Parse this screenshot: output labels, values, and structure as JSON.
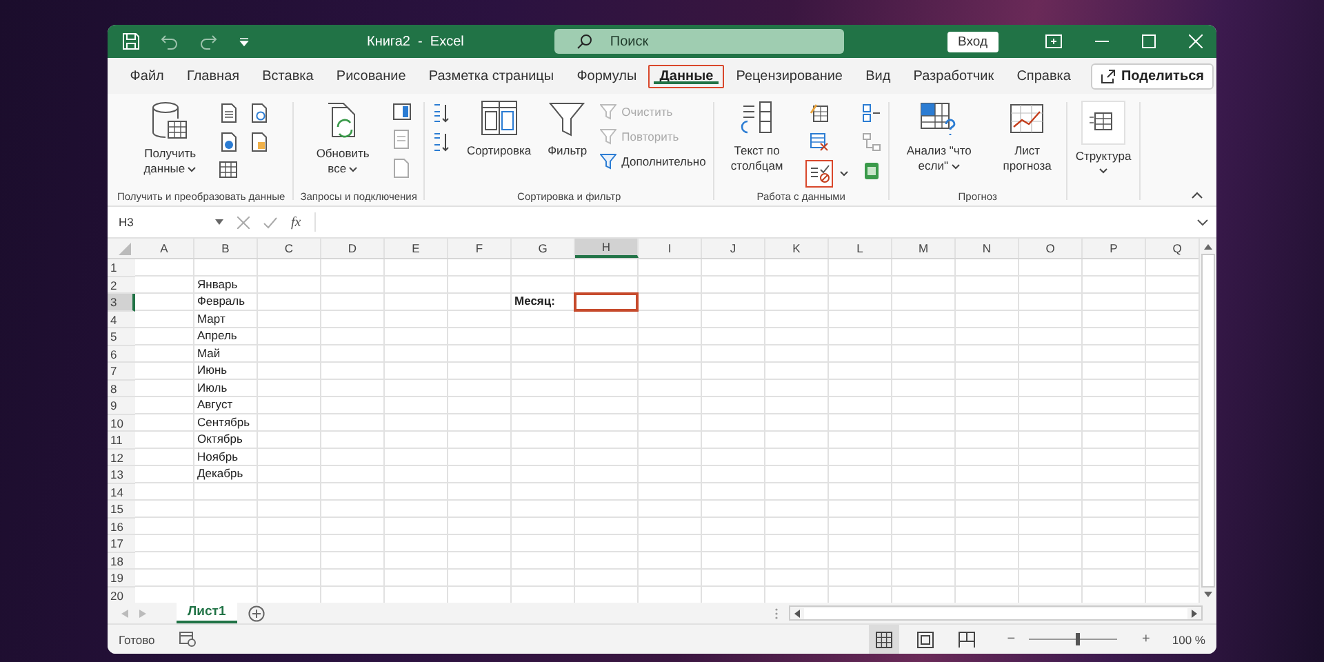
{
  "window": {
    "title": "Книга2  -  Excel",
    "search_placeholder": "Поиск",
    "sign_in": "Вход"
  },
  "tabs": [
    {
      "label": "Файл",
      "selected": false
    },
    {
      "label": "Главная",
      "selected": false
    },
    {
      "label": "Вставка",
      "selected": false
    },
    {
      "label": "Рисование",
      "selected": false
    },
    {
      "label": "Разметка страницы",
      "selected": false
    },
    {
      "label": "Формулы",
      "selected": false
    },
    {
      "label": "Данные",
      "selected": true
    },
    {
      "label": "Рецензирование",
      "selected": false
    },
    {
      "label": "Вид",
      "selected": false
    },
    {
      "label": "Разработчик",
      "selected": false
    },
    {
      "label": "Справка",
      "selected": false
    }
  ],
  "share": "Поделиться",
  "ribbon": {
    "get_data": {
      "button": "Получить данные",
      "caption": "Получить и преобразовать данные"
    },
    "queries": {
      "button": "Обновить все",
      "caption": "Запросы и подключения"
    },
    "sort_filter": {
      "buttons": [
        "Сортировка",
        "Фильтр"
      ],
      "commands": [
        {
          "label": "Очистить",
          "disabled": true
        },
        {
          "label": "Повторить",
          "disabled": true
        },
        {
          "label": "Дополнительно",
          "disabled": false
        }
      ],
      "caption": "Сортировка и фильтр"
    },
    "data_tools": {
      "button": "Текст по столбцам",
      "validation_highlighted": true,
      "caption": "Работа с данными"
    },
    "forecast": {
      "buttons": [
        "Анализ \"что если\"",
        "Лист прогноза"
      ],
      "caption": "Прогноз"
    },
    "outline": {
      "button": "Структура"
    }
  },
  "formula_bar": {
    "name_box": "H3",
    "fx": "fx"
  },
  "grid": {
    "columns": [
      {
        "label": "A",
        "selected": false
      },
      {
        "label": "B",
        "selected": false
      },
      {
        "label": "C",
        "selected": false
      },
      {
        "label": "D",
        "selected": false
      },
      {
        "label": "E",
        "selected": false
      },
      {
        "label": "F",
        "selected": false
      },
      {
        "label": "G",
        "selected": false
      },
      {
        "label": "H",
        "selected": true
      },
      {
        "label": "I",
        "selected": false
      },
      {
        "label": "J",
        "selected": false
      },
      {
        "label": "K",
        "selected": false
      },
      {
        "label": "L",
        "selected": false
      },
      {
        "label": "M",
        "selected": false
      },
      {
        "label": "N",
        "selected": false
      },
      {
        "label": "O",
        "selected": false
      },
      {
        "label": "P",
        "selected": false
      },
      {
        "label": "Q",
        "selected": false
      }
    ],
    "rows": [
      {
        "label": "1",
        "selected": false
      },
      {
        "label": "2",
        "selected": false,
        "column_b": "Январь"
      },
      {
        "label": "3",
        "selected": true,
        "column_b": "Февраль",
        "column_g": "Месяц:"
      },
      {
        "label": "4",
        "selected": false,
        "column_b": "Март"
      },
      {
        "label": "5",
        "selected": false,
        "column_b": "Апрель"
      },
      {
        "label": "6",
        "selected": false,
        "column_b": "Май"
      },
      {
        "label": "7",
        "selected": false,
        "column_b": "Июнь"
      },
      {
        "label": "8",
        "selected": false,
        "column_b": "Июль"
      },
      {
        "label": "9",
        "selected": false,
        "column_b": "Август"
      },
      {
        "label": "10",
        "selected": false,
        "column_b": "Сентябрь"
      },
      {
        "label": "11",
        "selected": false,
        "column_b": "Октябрь"
      },
      {
        "label": "12",
        "selected": false,
        "column_b": "Ноябрь"
      },
      {
        "label": "13",
        "selected": false,
        "column_b": "Декабрь"
      },
      {
        "label": "14",
        "selected": false
      },
      {
        "label": "15",
        "selected": false
      },
      {
        "label": "16",
        "selected": false
      },
      {
        "label": "17",
        "selected": false
      },
      {
        "label": "18",
        "selected": false
      },
      {
        "label": "19",
        "selected": false
      },
      {
        "label": "20",
        "selected": false
      }
    ]
  },
  "sheets": [
    {
      "label": "Лист1",
      "selected": true
    }
  ],
  "status_bar": {
    "status": "Готово",
    "views": [
      {
        "selected": true
      },
      {
        "selected": false
      },
      {
        "selected": false
      }
    ],
    "zoom_out": "−",
    "zoom_in": "+",
    "zoom": {
      "level": 0.55
    },
    "zoom_label": "100 %"
  }
}
